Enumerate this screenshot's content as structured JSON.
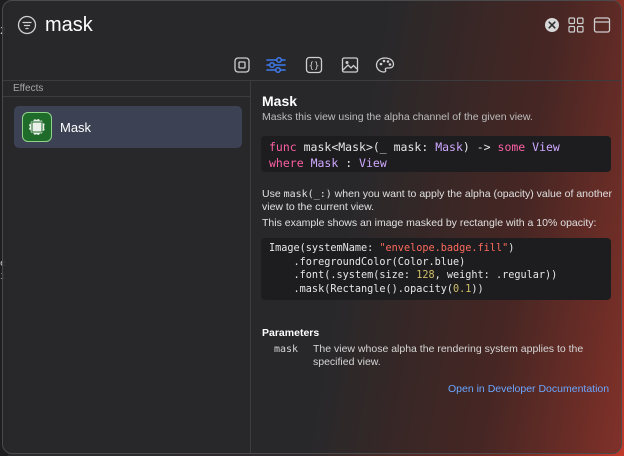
{
  "search": {
    "query": "mask"
  },
  "tabs": [
    {
      "icon": "square-icon",
      "active": false
    },
    {
      "icon": "sliders-icon",
      "active": true
    },
    {
      "icon": "braces-icon",
      "active": false
    },
    {
      "icon": "photo-icon",
      "active": false
    },
    {
      "icon": "palette-icon",
      "active": false
    }
  ],
  "sidebar": {
    "header": "Effects",
    "items": [
      {
        "label": "Mask",
        "selected": true
      }
    ]
  },
  "detail": {
    "title": "Mask",
    "subtitle": "Masks this view using the alpha channel of the given view.",
    "declaration": {
      "func_kw": "func",
      "signature_a": " mask<Mask>(_ mask: ",
      "type_mask": "Mask",
      "signature_b": ") -> ",
      "some_kw": "some",
      "type_view": "View",
      "where_kw": "where",
      "type_mask2": "Mask",
      "colon": " : ",
      "type_view2": "View"
    },
    "para1_a": "Use ",
    "para1_code": "mask(_:)",
    "para1_b": " when you want to apply the alpha (opacity) value of another view to the current view.",
    "para2": "This example shows an image masked by rectangle with a 10% opacity:",
    "example": {
      "l1a": "Image(systemName: ",
      "l1str": "\"envelope.badge.fill\"",
      "l1b": ")",
      "l2": "    .foregroundColor(Color.blue)",
      "l3a": "    .font(.system(size: ",
      "l3num": "128",
      "l3b": ", weight: .regular))",
      "l4a": "    .mask(Rectangle().opacity(",
      "l4num": "0.1",
      "l4b": "))"
    },
    "parameters_header": "Parameters",
    "param_name": "mask",
    "param_desc": "The view whose alpha the rendering system applies to the specified view.",
    "doc_link": "Open in Developer Documentation"
  },
  "desktop": {
    "glyph_top": "2",
    "glyph_mid1": "e",
    "glyph_mid2": "i"
  },
  "colors": {
    "accent": "#3d7bf0",
    "keyword": "#fc5fa3",
    "type": "#d0a8ff",
    "string": "#fc6a5d",
    "number": "#d0bf69",
    "link": "#6aa6ff"
  }
}
